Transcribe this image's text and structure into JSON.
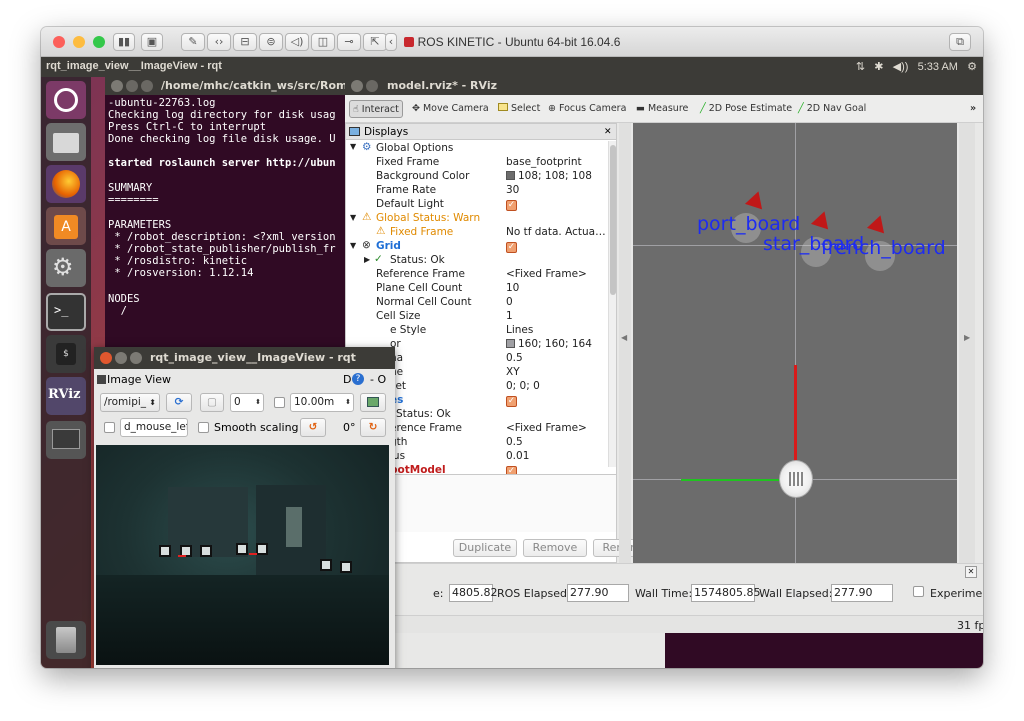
{
  "mac": {
    "title": "ROS KINETIC - Ubuntu 64-bit 16.04.6",
    "colors": {
      "close": "#fc605b",
      "minimize": "#fdbc40",
      "zoom": "#34c84a"
    }
  },
  "ubuntu": {
    "active_title": "rqt_image_view__ImageView - rqt",
    "clock": "5:33 AM"
  },
  "terminal": {
    "title": "/home/mhc/catkin_ws/src/RomiPi",
    "lines": [
      "-ubuntu-22763.log",
      "Checking log directory for disk usag",
      "Press Ctrl-C to interrupt",
      "Done checking log file disk usage. U",
      "",
      "started roslaunch server http://ubun",
      "",
      "SUMMARY",
      "========",
      "",
      "PARAMETERS",
      " * /robot_description: <?xml version",
      " * /robot_state_publisher/publish_fr",
      " * /rosdistro: kinetic",
      " * /rosversion: 1.12.14",
      "",
      "NODES",
      "  /"
    ]
  },
  "rviz": {
    "title": "model.rviz* - RViz",
    "toolbar": {
      "interact": "Interact",
      "move_camera": "Move Camera",
      "select": "Select",
      "focus_camera": "Focus Camera",
      "measure": "Measure",
      "pose_estimate": "2D Pose Estimate",
      "nav_goal": "2D Nav Goal",
      "more": "»"
    },
    "displays": {
      "header": "Displays",
      "close": "✕",
      "rows": [
        {
          "name": "Global Options",
          "value": ""
        },
        {
          "name": "Fixed Frame",
          "value": "base_footprint"
        },
        {
          "name": "Background Color",
          "value": "108; 108; 108"
        },
        {
          "name": "Frame Rate",
          "value": "30"
        },
        {
          "name": "Default Light",
          "value": ""
        },
        {
          "name": "Global Status: Warn",
          "value": ""
        },
        {
          "name": "Fixed Frame",
          "value": "No tf data.  Actua…"
        },
        {
          "name": "Grid",
          "value": ""
        },
        {
          "name": "Status: Ok",
          "value": ""
        },
        {
          "name": "Reference Frame",
          "value": "<Fixed Frame>"
        },
        {
          "name": "Plane Cell Count",
          "value": "10"
        },
        {
          "name": "Normal Cell Count",
          "value": "0"
        },
        {
          "name": "Cell Size",
          "value": "1"
        },
        {
          "name": "e Style",
          "value": "Lines"
        },
        {
          "name": "or",
          "value": "160; 160; 164"
        },
        {
          "name": "ha",
          "value": "0.5"
        },
        {
          "name": "ne",
          "value": "XY"
        },
        {
          "name": "set",
          "value": "0; 0; 0"
        },
        {
          "name": "es",
          "value": ""
        },
        {
          "name": "Status: Ok",
          "value": ""
        },
        {
          "name": "erence Frame",
          "value": "<Fixed Frame>"
        },
        {
          "name": "gth",
          "value": "0.5"
        },
        {
          "name": "ius",
          "value": "0.01"
        },
        {
          "name": "botModel",
          "value": ""
        }
      ]
    },
    "buttons": {
      "duplicate": "Duplicate",
      "remove": "Remove",
      "rename": "Rename"
    },
    "tf_labels": {
      "port": "port_board",
      "star": "star_board",
      "french": "french_board"
    },
    "time": {
      "ros_time_label": "e:",
      "ros_time": "4805.82",
      "ros_elapsed_label": "ROS Elapsed:",
      "ros_elapsed": "277.90",
      "wall_time_label": "Wall Time:",
      "wall_time": "1574805.85",
      "wall_elapsed_label": "Wall Elapsed:",
      "wall_elapsed": "277.90",
      "experimental": "Experimental",
      "fps": "31 fps"
    }
  },
  "rqt": {
    "title": "rqt_image_view__ImageView - rqt",
    "plugin_title": "Image View",
    "help_labels": "D",
    "help_question": "?",
    "help_close": "- O",
    "topic": "/romipi_",
    "refresh_icon": "⟳",
    "spin_value": "0",
    "timeout": "10.00m",
    "mouse_topic": "d_mouse_left",
    "smooth_scaling": "Smooth scaling",
    "rotation": "0°"
  }
}
